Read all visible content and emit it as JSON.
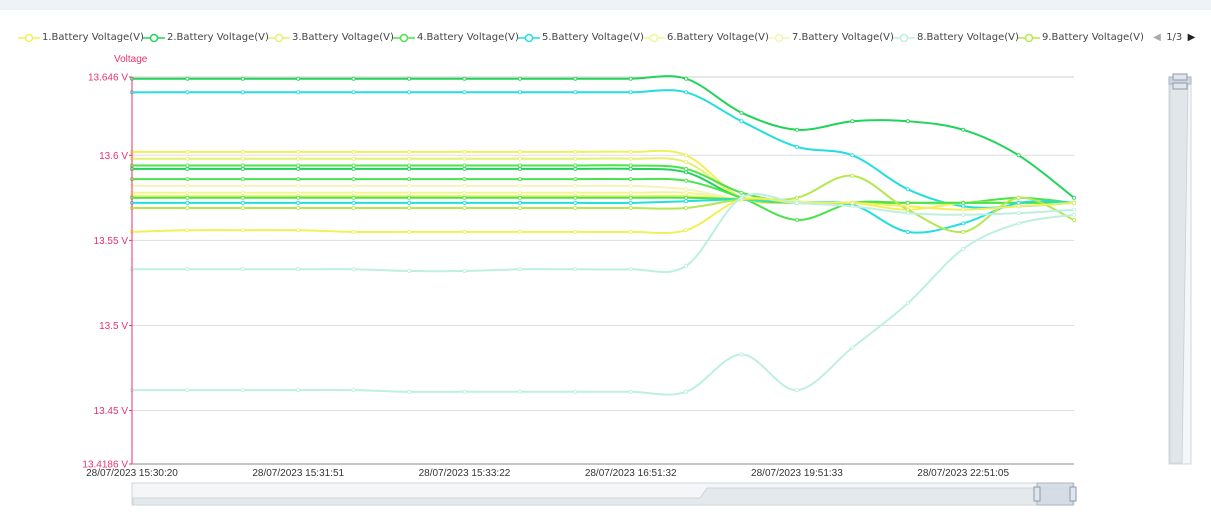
{
  "legend": {
    "items": [
      {
        "label": "1.Battery Voltage(V)",
        "color": "#f2ef5a"
      },
      {
        "label": "2.Battery Voltage(V)",
        "color": "#22d35a"
      },
      {
        "label": "3.Battery Voltage(V)",
        "color": "#e6f06e"
      },
      {
        "label": "4.Battery Voltage(V)",
        "color": "#4be34b"
      },
      {
        "label": "5.Battery Voltage(V)",
        "color": "#22dede"
      },
      {
        "label": "6.Battery Voltage(V)",
        "color": "#f1f59a"
      },
      {
        "label": "7.Battery Voltage(V)",
        "color": "#f6f3b8"
      },
      {
        "label": "8.Battery Voltage(V)",
        "color": "#bdf0de"
      },
      {
        "label": "9.Battery Voltage(V)",
        "color": "#b5e84e"
      }
    ],
    "pager": "1/3"
  },
  "colors": {
    "axis": "#e8336b",
    "grid": "#dddddd"
  },
  "chart_data": {
    "type": "line",
    "ylabel": "Voltage",
    "ylim": [
      13.4186,
      13.646
    ],
    "y_ticks": [
      "13.646 V",
      "13.6 V",
      "13.55 V",
      "13.5 V",
      "13.45 V",
      "13.4186 V"
    ],
    "x_ticks": [
      "28/07/2023 15:30:20",
      "28/07/2023 15:31:51",
      "28/07/2023 15:33:22",
      "28/07/2023 16:51:32",
      "28/07/2023 19:51:33",
      "28/07/2023 22:51:05"
    ],
    "x": [
      0,
      1,
      2,
      3,
      4,
      5,
      6,
      7,
      8,
      9,
      10,
      11,
      12,
      13,
      14,
      15,
      16,
      17
    ],
    "series": [
      {
        "color": "#22d35a",
        "values": [
          13.645,
          13.645,
          13.645,
          13.645,
          13.645,
          13.645,
          13.645,
          13.645,
          13.645,
          13.645,
          13.645,
          13.625,
          13.615,
          13.62,
          13.62,
          13.615,
          13.6,
          13.575
        ]
      },
      {
        "color": "#22dede",
        "values": [
          13.637,
          13.637,
          13.637,
          13.637,
          13.637,
          13.637,
          13.637,
          13.637,
          13.637,
          13.637,
          13.637,
          13.62,
          13.605,
          13.6,
          13.58,
          13.57,
          13.57,
          13.572
        ]
      },
      {
        "color": "#f2ef5a",
        "values": [
          13.602,
          13.602,
          13.602,
          13.602,
          13.602,
          13.602,
          13.602,
          13.602,
          13.602,
          13.602,
          13.6,
          13.575,
          13.572,
          13.572,
          13.572,
          13.572,
          13.572,
          13.572
        ]
      },
      {
        "color": "#e6f06e",
        "values": [
          13.598,
          13.598,
          13.598,
          13.598,
          13.598,
          13.598,
          13.598,
          13.598,
          13.598,
          13.598,
          13.596,
          13.575,
          13.572,
          13.572,
          13.572,
          13.572,
          13.572,
          13.572
        ]
      },
      {
        "color": "#4be34b",
        "values": [
          13.594,
          13.594,
          13.594,
          13.594,
          13.594,
          13.594,
          13.594,
          13.594,
          13.594,
          13.594,
          13.592,
          13.578,
          13.572,
          13.572,
          13.572,
          13.572,
          13.572,
          13.572
        ]
      },
      {
        "color": "#22d35a",
        "values": [
          13.592,
          13.592,
          13.592,
          13.592,
          13.592,
          13.592,
          13.592,
          13.592,
          13.592,
          13.592,
          13.59,
          13.575,
          13.572,
          13.572,
          13.572,
          13.572,
          13.572,
          13.572
        ]
      },
      {
        "color": "#4be34b",
        "values": [
          13.586,
          13.586,
          13.586,
          13.586,
          13.586,
          13.586,
          13.586,
          13.586,
          13.586,
          13.586,
          13.585,
          13.575,
          13.562,
          13.572,
          13.572,
          13.572,
          13.575,
          13.572
        ]
      },
      {
        "color": "#f6f3b8",
        "values": [
          13.582,
          13.582,
          13.582,
          13.582,
          13.582,
          13.582,
          13.582,
          13.582,
          13.582,
          13.582,
          13.58,
          13.574,
          13.573,
          13.572,
          13.572,
          13.572,
          13.572,
          13.572
        ]
      },
      {
        "color": "#f1f59a",
        "values": [
          13.578,
          13.578,
          13.578,
          13.578,
          13.578,
          13.578,
          13.578,
          13.578,
          13.578,
          13.578,
          13.578,
          13.574,
          13.573,
          13.572,
          13.572,
          13.572,
          13.572,
          13.572
        ]
      },
      {
        "color": "#f2ef5a",
        "values": [
          13.576,
          13.576,
          13.576,
          13.576,
          13.576,
          13.576,
          13.576,
          13.576,
          13.576,
          13.576,
          13.576,
          13.574,
          13.572,
          13.572,
          13.568,
          13.572,
          13.572,
          13.572
        ]
      },
      {
        "color": "#4be34b",
        "values": [
          13.575,
          13.575,
          13.575,
          13.575,
          13.575,
          13.575,
          13.575,
          13.575,
          13.575,
          13.575,
          13.575,
          13.574,
          13.572,
          13.572,
          13.572,
          13.572,
          13.572,
          13.572
        ]
      },
      {
        "color": "#22dede",
        "values": [
          13.572,
          13.572,
          13.572,
          13.572,
          13.572,
          13.572,
          13.572,
          13.572,
          13.572,
          13.572,
          13.573,
          13.574,
          13.572,
          13.571,
          13.555,
          13.56,
          13.572,
          13.572
        ]
      },
      {
        "color": "#b5e84e",
        "values": [
          13.569,
          13.569,
          13.569,
          13.569,
          13.569,
          13.569,
          13.569,
          13.569,
          13.569,
          13.569,
          13.569,
          13.574,
          13.575,
          13.588,
          13.568,
          13.555,
          13.575,
          13.562
        ]
      },
      {
        "color": "#f2ef5a",
        "values": [
          13.555,
          13.556,
          13.556,
          13.556,
          13.555,
          13.555,
          13.555,
          13.555,
          13.555,
          13.555,
          13.556,
          13.574,
          13.572,
          13.572,
          13.57,
          13.568,
          13.57,
          13.572
        ]
      },
      {
        "color": "#bdf0de",
        "values": [
          13.533,
          13.533,
          13.533,
          13.533,
          13.533,
          13.532,
          13.532,
          13.533,
          13.533,
          13.533,
          13.535,
          13.575,
          13.572,
          13.57,
          13.566,
          13.565,
          13.566,
          13.568
        ]
      },
      {
        "color": "#bdf0de",
        "values": [
          13.462,
          13.462,
          13.462,
          13.462,
          13.462,
          13.461,
          13.461,
          13.461,
          13.461,
          13.461,
          13.461,
          13.483,
          13.462,
          13.487,
          13.513,
          13.545,
          13.56,
          13.565
        ]
      }
    ]
  }
}
